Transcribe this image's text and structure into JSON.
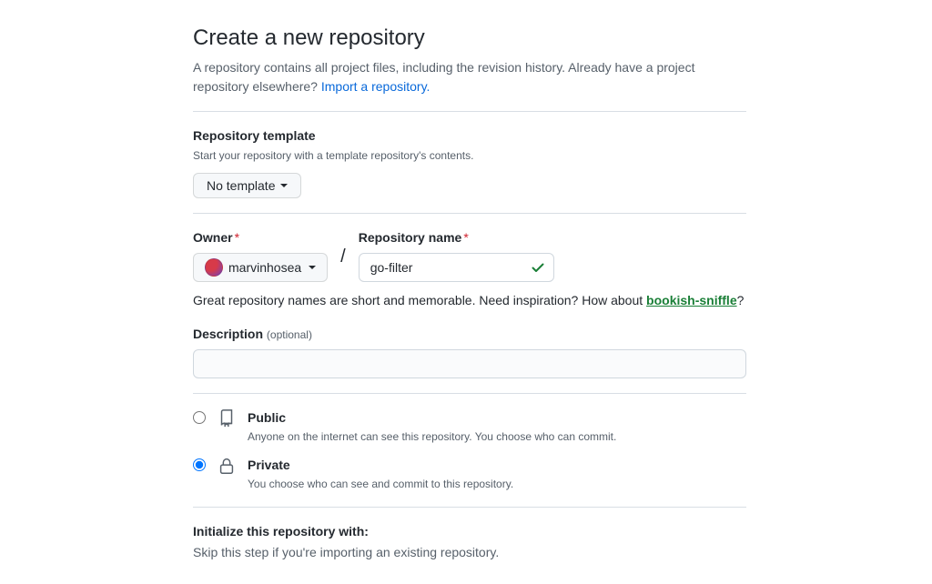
{
  "header": {
    "title": "Create a new repository",
    "subtitle_part1": "A repository contains all project files, including the revision history. Already have a project repository elsewhere? ",
    "import_link": "Import a repository."
  },
  "template": {
    "label": "Repository template",
    "desc": "Start your repository with a template repository's contents.",
    "button": "No template"
  },
  "owner": {
    "label": "Owner",
    "name": "marvinhosea"
  },
  "reponame": {
    "label": "Repository name",
    "value": "go-filter"
  },
  "hint": {
    "text_part1": "Great repository names are short and memorable. Need inspiration? How about ",
    "suggestion": "bookish-sniffle",
    "suffix": "?"
  },
  "description": {
    "label": "Description",
    "optional": "(optional)",
    "value": ""
  },
  "visibility": {
    "public": {
      "title": "Public",
      "desc": "Anyone on the internet can see this repository. You choose who can commit."
    },
    "private": {
      "title": "Private",
      "desc": "You choose who can see and commit to this repository."
    }
  },
  "initialize": {
    "heading": "Initialize this repository with:",
    "sub": "Skip this step if you're importing an existing repository."
  }
}
